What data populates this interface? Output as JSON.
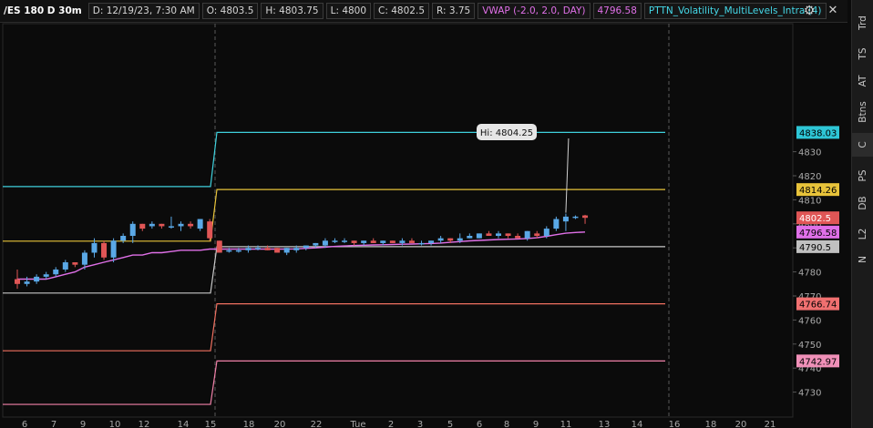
{
  "header": {
    "symbol": "/ES 180 D 30m",
    "date": "D: 12/19/23, 7:30 AM",
    "open": "O: 4803.5",
    "high": "H: 4803.75",
    "low": "L: 4800",
    "close": "C: 4802.5",
    "range": "R: 3.75",
    "vwap_study": "VWAP (-2.0, 2.0, DAY)",
    "vwap_value": "4796.58",
    "pttn_study": "PTTN_Volatility_MultiLevels_Intra (4)"
  },
  "sidebar": {
    "tabs": [
      "Trd",
      "TS",
      "AT",
      "Btns",
      "C",
      "PS",
      "DB",
      "L2",
      "N"
    ],
    "active": "C"
  },
  "chart_data": {
    "type": "candlestick",
    "ylim": [
      4720,
      4845
    ],
    "yticks": [
      4730,
      4740,
      4750,
      4760,
      4770,
      4780,
      4790,
      4800,
      4810,
      4820,
      4830
    ],
    "xtick_labels": [
      "6",
      "7",
      "9",
      "10",
      "12",
      "14",
      "15",
      "18",
      "20",
      "22",
      "Tue",
      "2",
      "3",
      "5",
      "6",
      "8",
      "9",
      "11",
      "13",
      "14",
      "16",
      "18",
      "20",
      "21"
    ],
    "session_break_tick": "15",
    "future_break_tick": "16",
    "candles": [
      {
        "o": 4777,
        "h": 4781,
        "l": 4773,
        "c": 4775
      },
      {
        "o": 4775,
        "h": 4778,
        "l": 4774,
        "c": 4776
      },
      {
        "o": 4776,
        "h": 4779,
        "l": 4775,
        "c": 4778
      },
      {
        "o": 4778,
        "h": 4780,
        "l": 4777,
        "c": 4779
      },
      {
        "o": 4779,
        "h": 4782,
        "l": 4778,
        "c": 4781
      },
      {
        "o": 4781,
        "h": 4785,
        "l": 4780,
        "c": 4784
      },
      {
        "o": 4784,
        "h": 4784,
        "l": 4782,
        "c": 4783
      },
      {
        "o": 4783,
        "h": 4789,
        "l": 4781,
        "c": 4788
      },
      {
        "o": 4788,
        "h": 4794,
        "l": 4786,
        "c": 4792
      },
      {
        "o": 4792,
        "h": 4793,
        "l": 4785,
        "c": 4786
      },
      {
        "o": 4786,
        "h": 4794,
        "l": 4784,
        "c": 4793
      },
      {
        "o": 4793,
        "h": 4796,
        "l": 4792,
        "c": 4795
      },
      {
        "o": 4795,
        "h": 4801,
        "l": 4792,
        "c": 4800
      },
      {
        "o": 4800,
        "h": 4800,
        "l": 4797,
        "c": 4798
      },
      {
        "o": 4799,
        "h": 4801,
        "l": 4798,
        "c": 4800
      },
      {
        "o": 4800,
        "h": 4800,
        "l": 4798,
        "c": 4799
      },
      {
        "o": 4799,
        "h": 4803,
        "l": 4798,
        "c": 4799
      },
      {
        "o": 4799,
        "h": 4801,
        "l": 4797,
        "c": 4800
      },
      {
        "o": 4800,
        "h": 4801,
        "l": 4798,
        "c": 4799
      },
      {
        "o": 4798,
        "h": 4802,
        "l": 4797,
        "c": 4802
      },
      {
        "o": 4801,
        "h": 4802,
        "l": 4793,
        "c": 4794
      },
      {
        "o": 4793,
        "h": 4793,
        "l": 4788,
        "c": 4788
      },
      {
        "o": 4789,
        "h": 4790,
        "l": 4788,
        "c": 4789
      },
      {
        "o": 4789,
        "h": 4790,
        "l": 4788,
        "c": 4789
      },
      {
        "o": 4789,
        "h": 4791,
        "l": 4788,
        "c": 4790
      },
      {
        "o": 4790,
        "h": 4791,
        "l": 4789,
        "c": 4790
      },
      {
        "o": 4790,
        "h": 4791,
        "l": 4789,
        "c": 4789
      },
      {
        "o": 4790,
        "h": 4790,
        "l": 4788,
        "c": 4788
      },
      {
        "o": 4788,
        "h": 4790,
        "l": 4787,
        "c": 4790
      },
      {
        "o": 4789,
        "h": 4791,
        "l": 4788,
        "c": 4790
      },
      {
        "o": 4790,
        "h": 4791,
        "l": 4789,
        "c": 4791
      },
      {
        "o": 4791,
        "h": 4792,
        "l": 4790,
        "c": 4792
      },
      {
        "o": 4791,
        "h": 4794,
        "l": 4790,
        "c": 4793
      },
      {
        "o": 4793,
        "h": 4794,
        "l": 4792,
        "c": 4793
      },
      {
        "o": 4793,
        "h": 4794,
        "l": 4792,
        "c": 4793
      },
      {
        "o": 4793,
        "h": 4793,
        "l": 4791,
        "c": 4792
      },
      {
        "o": 4792,
        "h": 4793,
        "l": 4791,
        "c": 4793
      },
      {
        "o": 4793,
        "h": 4794,
        "l": 4792,
        "c": 4792
      },
      {
        "o": 4792,
        "h": 4793,
        "l": 4791,
        "c": 4793
      },
      {
        "o": 4793,
        "h": 4793,
        "l": 4792,
        "c": 4792
      },
      {
        "o": 4792,
        "h": 4794,
        "l": 4791,
        "c": 4793
      },
      {
        "o": 4793,
        "h": 4794,
        "l": 4792,
        "c": 4792
      },
      {
        "o": 4792,
        "h": 4793,
        "l": 4791,
        "c": 4792
      },
      {
        "o": 4792,
        "h": 4793,
        "l": 4791,
        "c": 4793
      },
      {
        "o": 4793,
        "h": 4795,
        "l": 4792,
        "c": 4794
      },
      {
        "o": 4794,
        "h": 4794,
        "l": 4792,
        "c": 4793
      },
      {
        "o": 4793,
        "h": 4796,
        "l": 4792,
        "c": 4794
      },
      {
        "o": 4794,
        "h": 4796,
        "l": 4794,
        "c": 4795
      },
      {
        "o": 4794,
        "h": 4796,
        "l": 4794,
        "c": 4796
      },
      {
        "o": 4796,
        "h": 4797,
        "l": 4795,
        "c": 4795
      },
      {
        "o": 4795,
        "h": 4797,
        "l": 4794,
        "c": 4796
      },
      {
        "o": 4796,
        "h": 4796,
        "l": 4794,
        "c": 4795
      },
      {
        "o": 4795,
        "h": 4796,
        "l": 4794,
        "c": 4794
      },
      {
        "o": 4794,
        "h": 4797,
        "l": 4793,
        "c": 4797
      },
      {
        "o": 4796,
        "h": 4797,
        "l": 4794,
        "c": 4795
      },
      {
        "o": 4795,
        "h": 4799,
        "l": 4794,
        "c": 4798
      },
      {
        "o": 4798,
        "h": 4803,
        "l": 4797,
        "c": 4802
      },
      {
        "o": 4801,
        "h": 4804.25,
        "l": 4797,
        "c": 4803
      },
      {
        "o": 4803,
        "h": 4803.5,
        "l": 4802,
        "c": 4803
      },
      {
        "o": 4803.5,
        "h": 4803.75,
        "l": 4800,
        "c": 4802.5
      }
    ],
    "vwap": [
      4777,
      4777,
      4777,
      4777,
      4778,
      4779,
      4780,
      4782,
      4783,
      4784,
      4785,
      4786,
      4787,
      4787,
      4788,
      4788,
      4788.5,
      4789,
      4789,
      4789,
      4789.5,
      4789.5,
      4789.5,
      4789.5,
      4789.5,
      4789.5,
      4789.5,
      4789.5,
      4789.5,
      4789.6,
      4789.8,
      4790,
      4790.3,
      4790.6,
      4790.8,
      4791,
      4791.1,
      4791.2,
      4791.3,
      4791.4,
      4791.5,
      4791.6,
      4791.7,
      4791.8,
      4792,
      4792.3,
      4792.6,
      4792.9,
      4793.1,
      4793.3,
      4793.5,
      4793.6,
      4793.7,
      4793.9,
      4794.2,
      4794.8,
      4795.5,
      4796.1,
      4796.4,
      4796.58
    ],
    "levels": [
      {
        "color": "#3fd0dc",
        "prev": 4815.5,
        "cur": 4838.03
      },
      {
        "color": "#e8c33a",
        "prev": 4792.8,
        "cur": 4814.26
      },
      {
        "color": "#c8c8c8",
        "prev": 4771.2,
        "cur": 4790.5
      },
      {
        "color": "#f07060",
        "prev": 4747.2,
        "cur": 4766.74
      },
      {
        "color": "#f080a8",
        "prev": 4724.9,
        "cur": 4742.97
      }
    ],
    "price_tags": [
      {
        "label": "4838.03",
        "value": 4838.03,
        "bg": "#2ec6d6",
        "fg": "#000"
      },
      {
        "label": "4814.26",
        "value": 4814.26,
        "bg": "#e8c33a",
        "fg": "#000"
      },
      {
        "label": "4802.5",
        "value": 4802.5,
        "bg": "#e05656",
        "fg": "#fff"
      },
      {
        "label": "4796.58",
        "value": 4796.58,
        "bg": "#e070e8",
        "fg": "#000"
      },
      {
        "label": "4790.5",
        "value": 4790.5,
        "bg": "#c0c0c0",
        "fg": "#000"
      },
      {
        "label": "4766.74",
        "value": 4766.74,
        "bg": "#f07070",
        "fg": "#000"
      },
      {
        "label": "4742.97",
        "value": 4742.97,
        "bg": "#f090b8",
        "fg": "#000"
      }
    ],
    "annotation": {
      "text": "Hi: 4804.25",
      "candle": 57
    },
    "colors": {
      "up": "#5aa8e6",
      "down": "#e05656",
      "vwap": "#e070e8",
      "axis": "#a9a9a9",
      "grid": "#303030"
    }
  }
}
